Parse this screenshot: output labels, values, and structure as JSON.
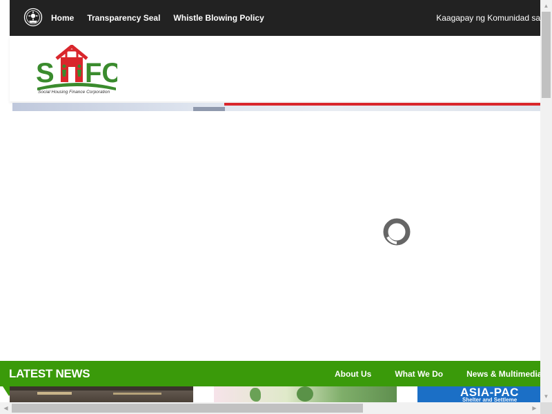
{
  "topbar": {
    "nav": [
      {
        "label": "Home"
      },
      {
        "label": "Transparency Seal"
      },
      {
        "label": "Whistle Blowing Policy"
      }
    ],
    "tagline": "Kaagapay ng Komunidad sa"
  },
  "header": {
    "logo_text": "SHFC",
    "logo_subtitle": "Social Housing Finance Corporation"
  },
  "latest": {
    "title": "LATEST NEWS",
    "nav": [
      {
        "label": "About Us"
      },
      {
        "label": "What We Do"
      },
      {
        "label": "News & Multimedia"
      }
    ]
  },
  "thumbnails": {
    "third_title": "ASIA-PAC",
    "third_subtitle": "Shelter and Settleme"
  },
  "colors": {
    "topbar_bg": "#222222",
    "accent_green": "#3a9a0a",
    "logo_red": "#d9262c",
    "logo_green": "#3a8b2d"
  },
  "icons": {
    "seal": "government-seal-icon",
    "loader": "loading-spinner-icon"
  }
}
